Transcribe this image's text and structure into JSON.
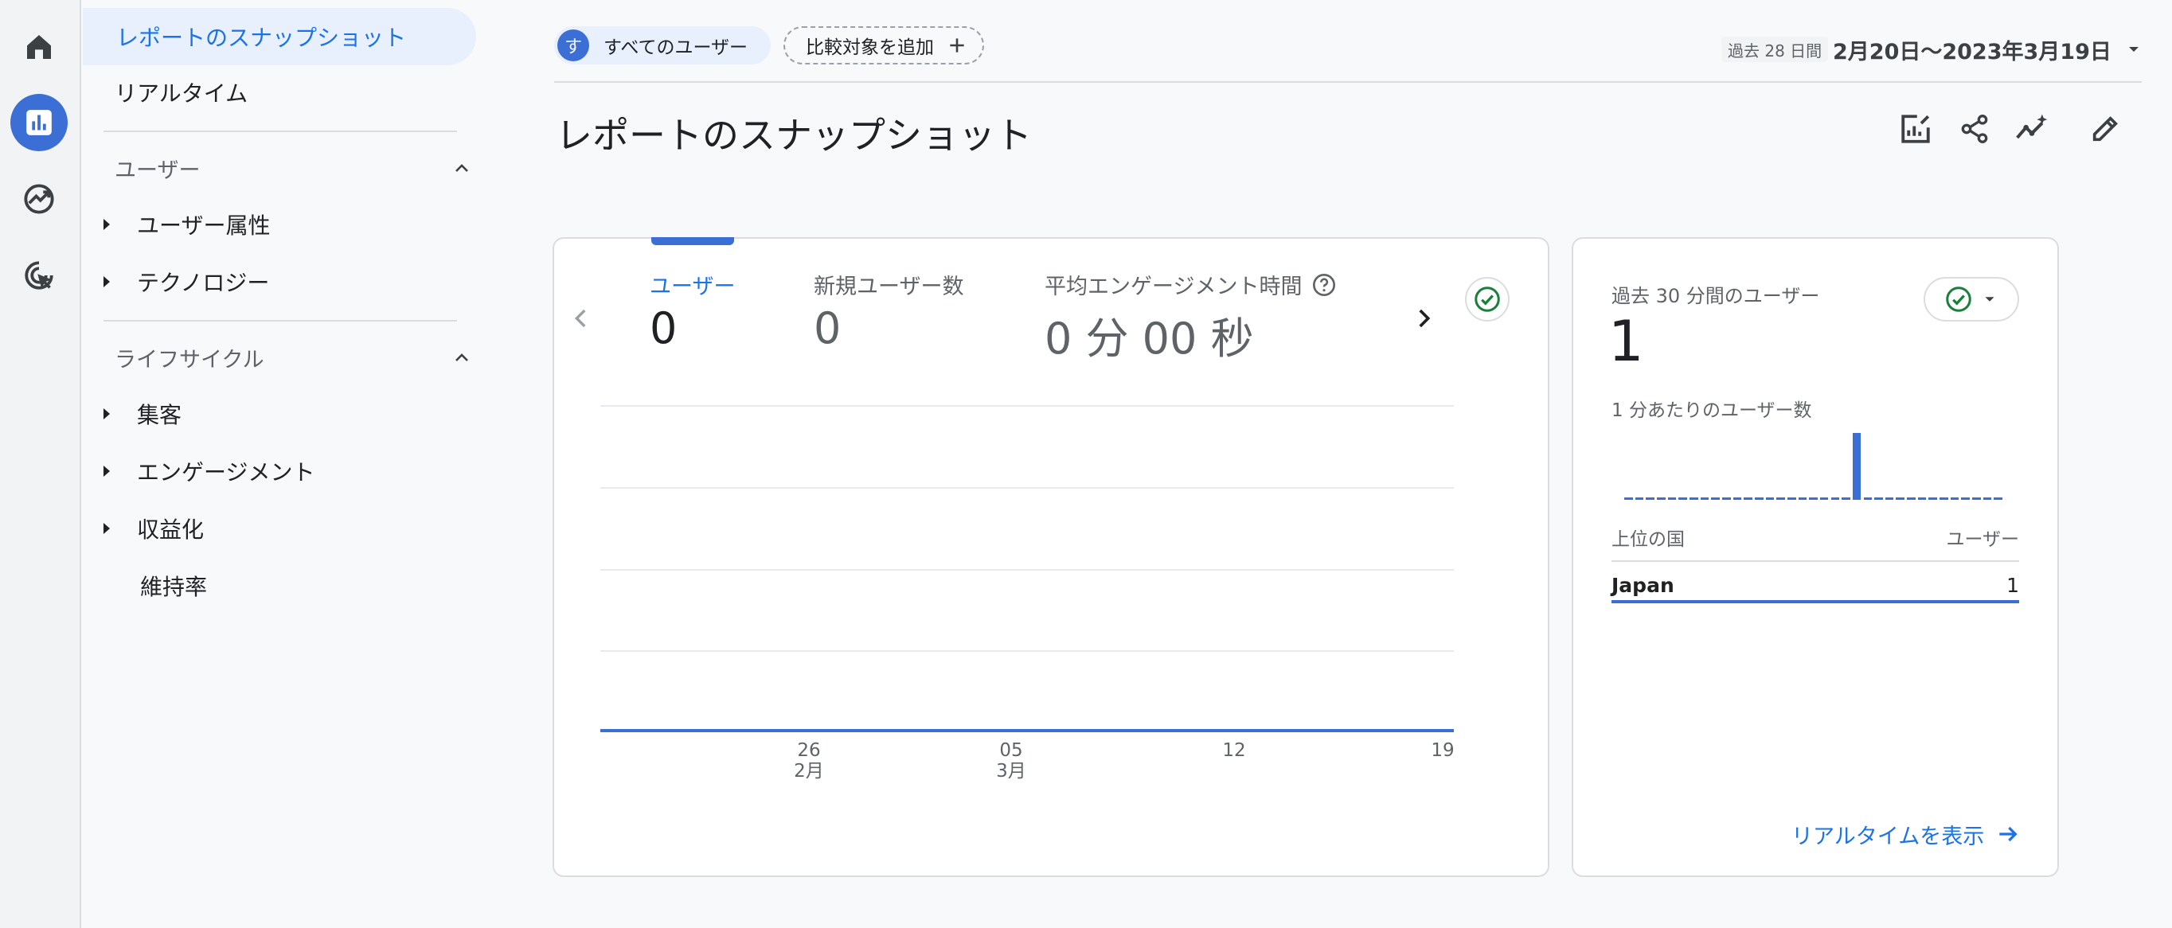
{
  "nav": {
    "snapshot": "レポートのスナップショット",
    "realtime": "リアルタイム",
    "user_section": "ユーザー",
    "user_items": [
      "ユーザー属性",
      "テクノロジー"
    ],
    "lifecycle_section": "ライフサイクル",
    "lifecycle_items": [
      "集客",
      "エンゲージメント",
      "収益化",
      "維持率"
    ]
  },
  "header": {
    "segment_avatar": "す",
    "segment_label": "すべてのユーザー",
    "add_comparison": "比較対象を追加",
    "range_badge": "過去 28 日間",
    "date_range": "2月20日〜2023年3月19日",
    "page_title": "レポートのスナップショット"
  },
  "main_card": {
    "metrics": [
      {
        "label": "ユーザー",
        "value": "0"
      },
      {
        "label": "新規ユーザー数",
        "value": "0"
      },
      {
        "label": "平均エンゲージメント時間",
        "value": "0 分 00 秒"
      }
    ],
    "x_ticks": [
      {
        "day": "26",
        "month": "2月"
      },
      {
        "day": "05",
        "month": "3月"
      },
      {
        "day": "12",
        "month": ""
      },
      {
        "day": "19",
        "month": ""
      }
    ]
  },
  "realtime_card": {
    "title": "過去 30 分間のユーザー",
    "count": "1",
    "per_minute_label": "1 分あたりのユーザー数",
    "per_minute_values": [
      0,
      0,
      0,
      0,
      0,
      0,
      0,
      0,
      0,
      0,
      0,
      0,
      0,
      0,
      0,
      0,
      0,
      0,
      0,
      0,
      0,
      1,
      0,
      0,
      0,
      0,
      0,
      0,
      0,
      0,
      0,
      0,
      0,
      0,
      0
    ],
    "table_header_country": "上位の国",
    "table_header_users": "ユーザー",
    "rows": [
      {
        "country": "Japan",
        "users": "1"
      }
    ],
    "view_realtime": "リアルタイムを表示"
  },
  "chart_data": {
    "type": "line",
    "x": [
      "2023-02-20",
      "2023-02-26",
      "2023-03-05",
      "2023-03-12",
      "2023-03-19"
    ],
    "series": [
      {
        "values": [
          0,
          0,
          0,
          0,
          0
        ]
      }
    ],
    "x_tick_labels": [
      "26 2月",
      "05 3月",
      "12",
      "19"
    ],
    "grid": true
  },
  "colors": {
    "accent": "#1a73e8",
    "bar": "#3c6fd6",
    "success": "#188038"
  }
}
